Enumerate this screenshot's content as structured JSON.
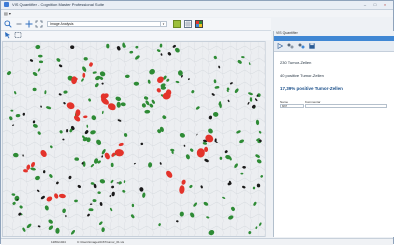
{
  "window": {
    "title": "VIS Quantifier - Cognition Master Professional Suite",
    "minimize": "–",
    "maximize": "□",
    "close": "×"
  },
  "menu": {
    "file": "▤ ▾"
  },
  "toolbar": {
    "layer_select_value": "Image Analysis",
    "layer_select_dd": "▾"
  },
  "panel": {
    "header": "VIS Quantifier",
    "tab_label": "VIS Quantifier",
    "stats": {
      "total_cells": "230 Tumor-Zellen",
      "positive_cells": "40 positive Tumor-Zellen",
      "percent_positive": "17,39% positive Tumor-Zellen"
    },
    "fields": {
      "name_label": "Name",
      "name_value": "Ki67",
      "comment_label": "Kommentar",
      "comment_value": ""
    }
  },
  "status": {
    "left": "1280x1024",
    "center": "C:\\Users\\Images\\Ki67\\tumor_01.vis"
  },
  "colors": {
    "positive_nucleus": "#e3332b",
    "negative_nucleus": "#2e8b35",
    "other_object": "#1a1a1a",
    "tissue_bg": "#eceef1",
    "accent": "#3f87d4"
  }
}
